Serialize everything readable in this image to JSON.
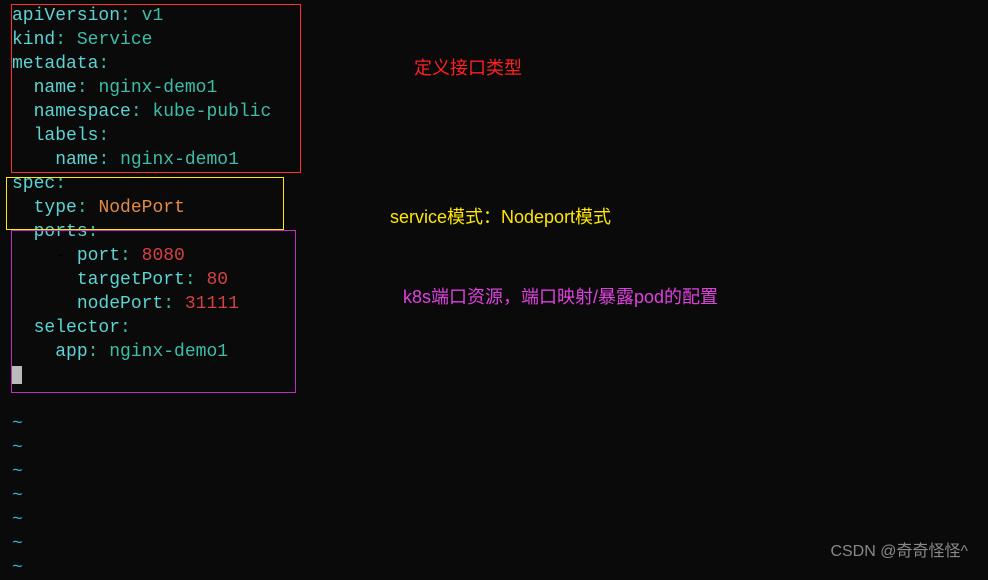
{
  "yaml": {
    "l1_k": "apiVersion",
    "l1_v": "v1",
    "l2_k": "kind",
    "l2_v": "Service",
    "l3_k": "metadata",
    "l4_k": "name",
    "l4_v": "nginx-demo1",
    "l5_k": "namespace",
    "l5_v": "kube-public",
    "l6_k": "labels",
    "l7_k": "name",
    "l7_v": "nginx-demo1",
    "l8_k": "spec",
    "l9_k": "type",
    "l9_v": "NodePort",
    "l10_k": "ports",
    "l11_k": "port",
    "l11_v": "8080",
    "l12_k": "targetPort",
    "l12_v": "80",
    "l13_k": "nodePort",
    "l13_v": "31111",
    "l14_k": "selector",
    "l15_k": "app",
    "l15_v": "nginx-demo1"
  },
  "annotations": {
    "red": "定义接口类型",
    "yellow": "service模式：Nodeport模式",
    "magenta": "k8s端口资源，端口映射/暴露pod的配置"
  },
  "tilde": "~",
  "watermark": "CSDN @奇奇怪怪^"
}
